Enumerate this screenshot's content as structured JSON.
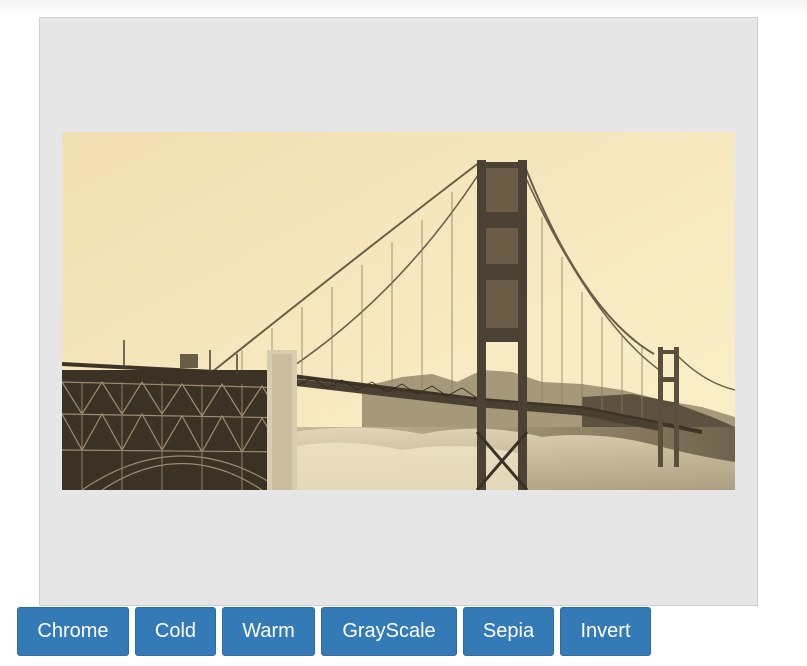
{
  "filters": {
    "buttons": [
      {
        "label": "Chrome"
      },
      {
        "label": "Cold"
      },
      {
        "label": "Warm"
      },
      {
        "label": "GrayScale"
      },
      {
        "label": "Sepia"
      },
      {
        "label": "Invert"
      }
    ],
    "button_color": "#337ab7"
  },
  "image": {
    "subject": "golden-gate-bridge",
    "filter_applied": "sepia"
  }
}
